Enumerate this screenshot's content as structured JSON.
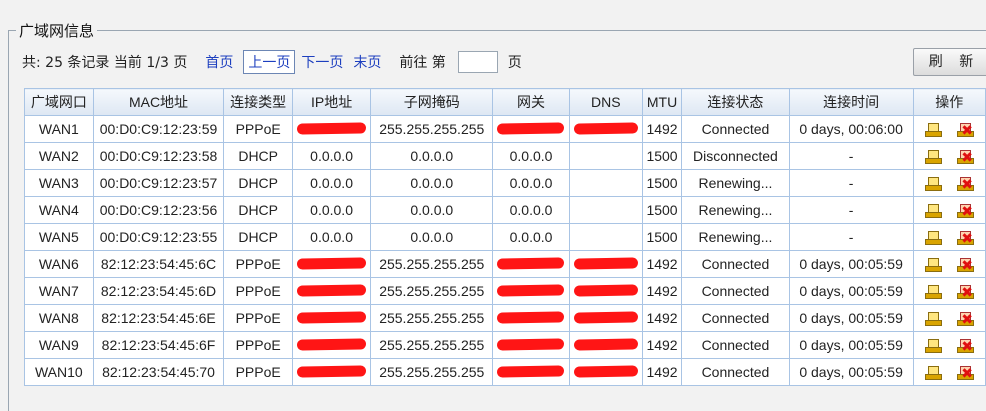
{
  "legend": "广域网信息",
  "pager": {
    "summary": "共: 25 条记录 当前 1/3 页",
    "first": "首页",
    "prev": "上一页",
    "next": "下一页",
    "last": "末页",
    "goto_prefix": "前往 第",
    "goto_suffix": "页",
    "goto_value": ""
  },
  "refresh_label": "刷 新",
  "columns": [
    "广域网口",
    "MAC地址",
    "连接类型",
    "IP地址",
    "子网掩码",
    "网关",
    "DNS",
    "MTU",
    "连接状态",
    "连接时间",
    "操作"
  ],
  "rows": [
    {
      "port": "WAN1",
      "mac": "00:D0:C9:12:23:59",
      "type": "PPPoE",
      "ip": "",
      "mask": "255.255.255.255",
      "gw": "",
      "dns": "",
      "mtu": "1492",
      "status": "Connected",
      "time": "0 days, 00:06:00",
      "redacted": true
    },
    {
      "port": "WAN2",
      "mac": "00:D0:C9:12:23:58",
      "type": "DHCP",
      "ip": "0.0.0.0",
      "mask": "0.0.0.0",
      "gw": "0.0.0.0",
      "dns": "",
      "mtu": "1500",
      "status": "Disconnected",
      "time": "-",
      "redacted": false
    },
    {
      "port": "WAN3",
      "mac": "00:D0:C9:12:23:57",
      "type": "DHCP",
      "ip": "0.0.0.0",
      "mask": "0.0.0.0",
      "gw": "0.0.0.0",
      "dns": "",
      "mtu": "1500",
      "status": "Renewing...",
      "time": "-",
      "redacted": false
    },
    {
      "port": "WAN4",
      "mac": "00:D0:C9:12:23:56",
      "type": "DHCP",
      "ip": "0.0.0.0",
      "mask": "0.0.0.0",
      "gw": "0.0.0.0",
      "dns": "",
      "mtu": "1500",
      "status": "Renewing...",
      "time": "-",
      "redacted": false
    },
    {
      "port": "WAN5",
      "mac": "00:D0:C9:12:23:55",
      "type": "DHCP",
      "ip": "0.0.0.0",
      "mask": "0.0.0.0",
      "gw": "0.0.0.0",
      "dns": "",
      "mtu": "1500",
      "status": "Renewing...",
      "time": "-",
      "redacted": false
    },
    {
      "port": "WAN6",
      "mac": "82:12:23:54:45:6C",
      "type": "PPPoE",
      "ip": "",
      "mask": "255.255.255.255",
      "gw": "",
      "dns": "",
      "mtu": "1492",
      "status": "Connected",
      "time": "0 days, 00:05:59",
      "redacted": true
    },
    {
      "port": "WAN7",
      "mac": "82:12:23:54:45:6D",
      "type": "PPPoE",
      "ip": "",
      "mask": "255.255.255.255",
      "gw": "",
      "dns": "",
      "mtu": "1492",
      "status": "Connected",
      "time": "0 days, 00:05:59",
      "redacted": true
    },
    {
      "port": "WAN8",
      "mac": "82:12:23:54:45:6E",
      "type": "PPPoE",
      "ip": "",
      "mask": "255.255.255.255",
      "gw": "",
      "dns": "",
      "mtu": "1492",
      "status": "Connected",
      "time": "0 days, 00:05:59",
      "redacted": true
    },
    {
      "port": "WAN9",
      "mac": "82:12:23:54:45:6F",
      "type": "PPPoE",
      "ip": "",
      "mask": "255.255.255.255",
      "gw": "",
      "dns": "",
      "mtu": "1492",
      "status": "Connected",
      "time": "0 days, 00:05:59",
      "redacted": true
    },
    {
      "port": "WAN10",
      "mac": "82:12:23:54:45:70",
      "type": "PPPoE",
      "ip": "",
      "mask": "255.255.255.255",
      "gw": "",
      "dns": "",
      "mtu": "1492",
      "status": "Connected",
      "time": "0 days, 00:05:59",
      "redacted": true
    }
  ],
  "colors": {
    "header_bg": "#dde7f3",
    "border": "#a9c4e4",
    "redaction": "#ff1515",
    "link": "#1d3fbf"
  },
  "icons": {
    "edit": "connect-icon",
    "delete": "disconnect-icon"
  }
}
